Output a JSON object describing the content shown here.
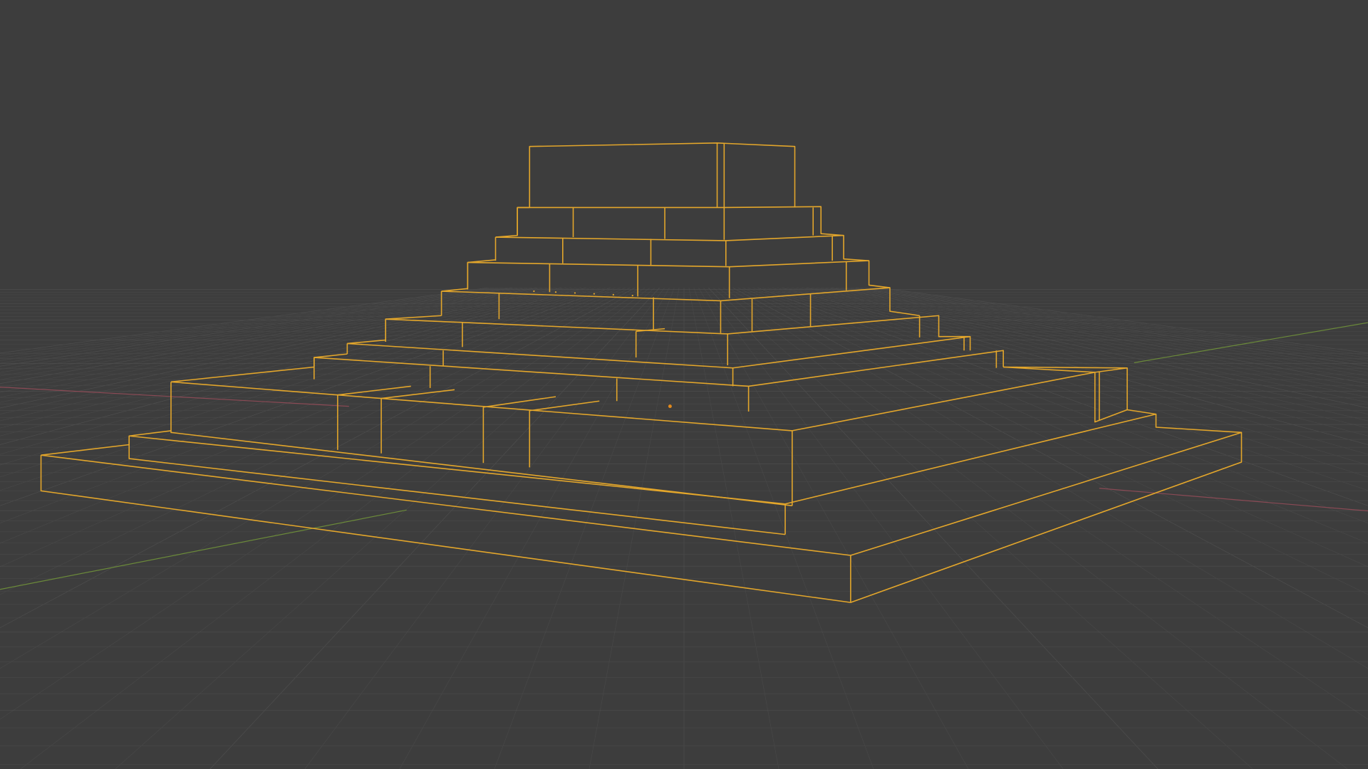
{
  "viewport": {
    "mode": "wireframe",
    "show_floor_grid": true,
    "show_x_axis": true,
    "show_y_axis": true,
    "selection": "selected-object-outline"
  },
  "colors": {
    "background": "#3d3d3d",
    "grid_minor": "#474747",
    "grid_major": "#4d4d4d",
    "x_axis": "#8a4a55",
    "y_axis": "#6b8a3a",
    "selection_outline": "#e3a62b",
    "object_origin": "#e38a1c"
  },
  "object": {
    "name": "stepped-pyramid",
    "selected": true
  }
}
